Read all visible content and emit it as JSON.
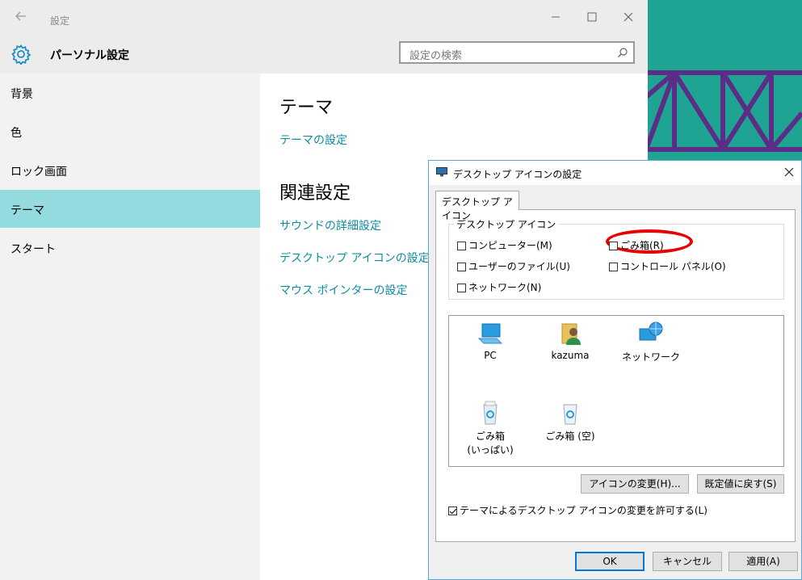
{
  "settings": {
    "title": "設定",
    "header_title": "パーソナル設定",
    "search_placeholder": "設定の検索",
    "nav": [
      "背景",
      "色",
      "ロック画面",
      "テーマ",
      "スタート"
    ],
    "active_nav": "テーマ",
    "content": {
      "theme_heading": "テーマ",
      "theme_link": "テーマの設定",
      "related_heading": "関連設定",
      "related_links": [
        "サウンドの詳細設定",
        "デスクトップ アイコンの設定",
        "マウス ポインターの設定"
      ]
    }
  },
  "dialog": {
    "title": "デスクトップ アイコンの設定",
    "tab": "デスクトップ アイコン",
    "group_label": "デスクトップ アイコン",
    "checkboxes": {
      "computer": "コンピューター(M)",
      "recycle": "ごみ箱(R)",
      "user_files": "ユーザーのファイル(U)",
      "control_panel": "コントロール パネル(O)",
      "network": "ネットワーク(N)"
    },
    "icons": {
      "pc": "PC",
      "user": "kazuma",
      "network": "ネットワーク",
      "recycle_full_1": "ごみ箱",
      "recycle_full_2": "(いっぱい)",
      "recycle_empty": "ごみ箱 (空)"
    },
    "buttons": {
      "change_icon": "アイコンの変更(H)...",
      "restore_default": "既定値に戻す(S)",
      "ok": "OK",
      "cancel": "キャンセル",
      "apply": "適用(A)"
    },
    "allow_themes": "テーマによるデスクトップ アイコンの変更を許可する(L)",
    "allow_themes_checked": true
  },
  "colors": {
    "accent_link": "#0e8ca0",
    "nav_active": "#94dbe0",
    "desktop_bg": "#1fa393",
    "highlight": "#e60000"
  }
}
